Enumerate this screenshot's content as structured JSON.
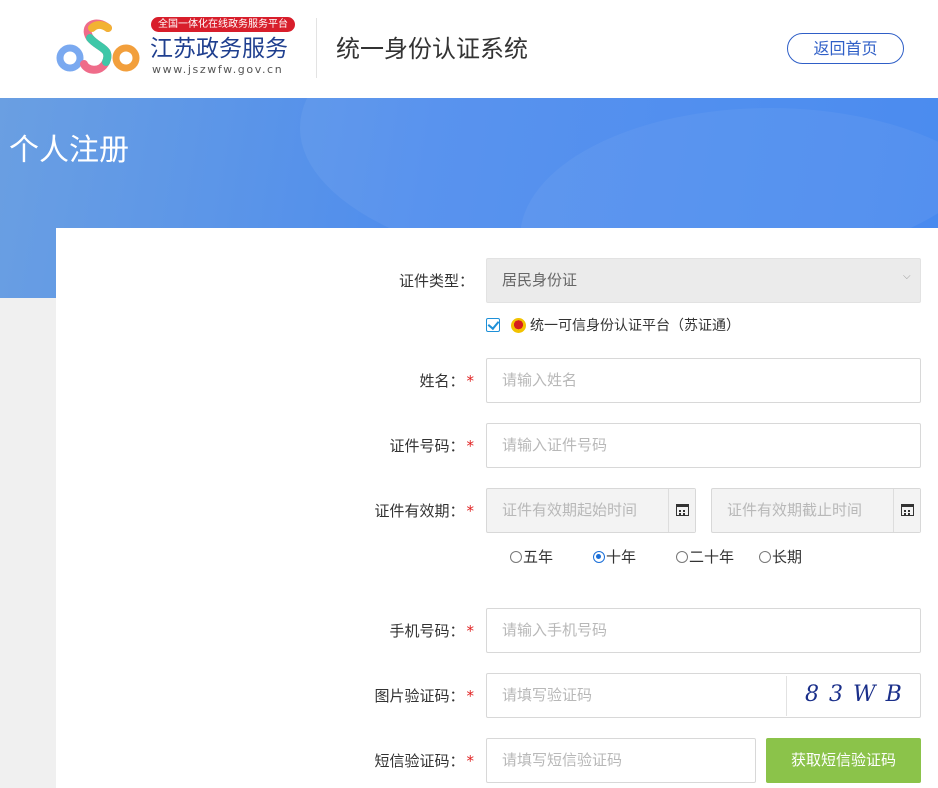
{
  "header": {
    "badge": "全国一体化在线政务服务平台",
    "brand_name": "江苏政务服务",
    "brand_url": "www.jszwfw.gov.cn",
    "system_title": "统一身份认证系统",
    "home_button": "返回首页",
    "logo_icon": "jiangsu-s-logo-icon"
  },
  "banner": {
    "title": "个人注册"
  },
  "form": {
    "id_type": {
      "label": "证件类型：",
      "value": "居民身份证"
    },
    "trust_platform": {
      "checked": true,
      "label": "统一可信身份认证平台（苏证通）"
    },
    "name": {
      "label": "姓名：",
      "required_mark": "*",
      "placeholder": "请输入姓名"
    },
    "id_number": {
      "label": "证件号码：",
      "required_mark": "*",
      "placeholder": "请输入证件号码"
    },
    "validity": {
      "label": "证件有效期：",
      "required_mark": "*",
      "start_placeholder": "证件有效期起始时间",
      "end_placeholder": "证件有效期截止时间",
      "options": [
        "五年",
        "十年",
        "二十年",
        "长期"
      ],
      "selected": "十年"
    },
    "phone": {
      "label": "手机号码：",
      "required_mark": "*",
      "placeholder": "请输入手机号码"
    },
    "captcha": {
      "label": "图片验证码：",
      "required_mark": "*",
      "placeholder": "请填写验证码",
      "image_text": "83WB"
    },
    "sms": {
      "label": "短信验证码：",
      "required_mark": "*",
      "placeholder": "请填写短信验证码",
      "button": "获取短信验证码"
    }
  },
  "colors": {
    "accent": "#2f5fc7",
    "banner": "#4f8ded",
    "sms_button": "#8bc34a",
    "required": "#e02020",
    "badge": "#d81e2b"
  }
}
